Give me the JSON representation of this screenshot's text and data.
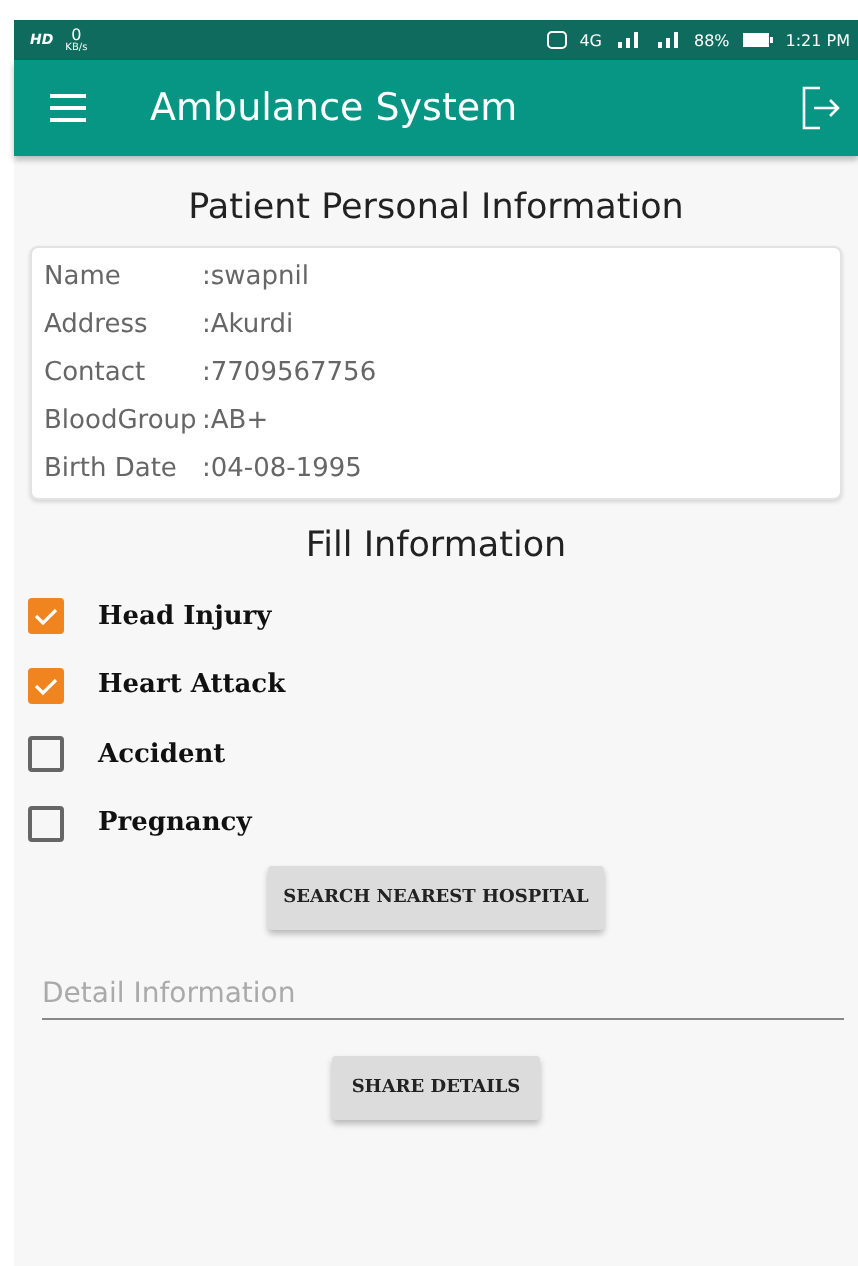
{
  "status_bar": {
    "hd": "HD",
    "speed": "0",
    "speed_unit": "KB/s",
    "network": "4G",
    "battery": "88%",
    "time": "1:21 PM"
  },
  "app_bar": {
    "title": "Ambulance System"
  },
  "patient_info": {
    "title": "Patient Personal Information",
    "rows": [
      {
        "label": "Name",
        "value": ":swapnil"
      },
      {
        "label": "Address",
        "value": ":Akurdi"
      },
      {
        "label": "Contact",
        "value": ":7709567756"
      },
      {
        "label": "BloodGroup",
        "value": ":AB+"
      },
      {
        "label": "Birth Date",
        "value": ":04-08-1995"
      }
    ]
  },
  "fill_info": {
    "title": "Fill Information",
    "options": [
      {
        "label": "Head Injury",
        "checked": true
      },
      {
        "label": "Heart Attack",
        "checked": true
      },
      {
        "label": "Accident",
        "checked": false
      },
      {
        "label": "Pregnancy",
        "checked": false
      }
    ],
    "search_button": "SEARCH NEAREST HOSPITAL",
    "detail_field": {
      "placeholder": "Detail Information"
    },
    "share_button": "SHARE DETAILS"
  }
}
